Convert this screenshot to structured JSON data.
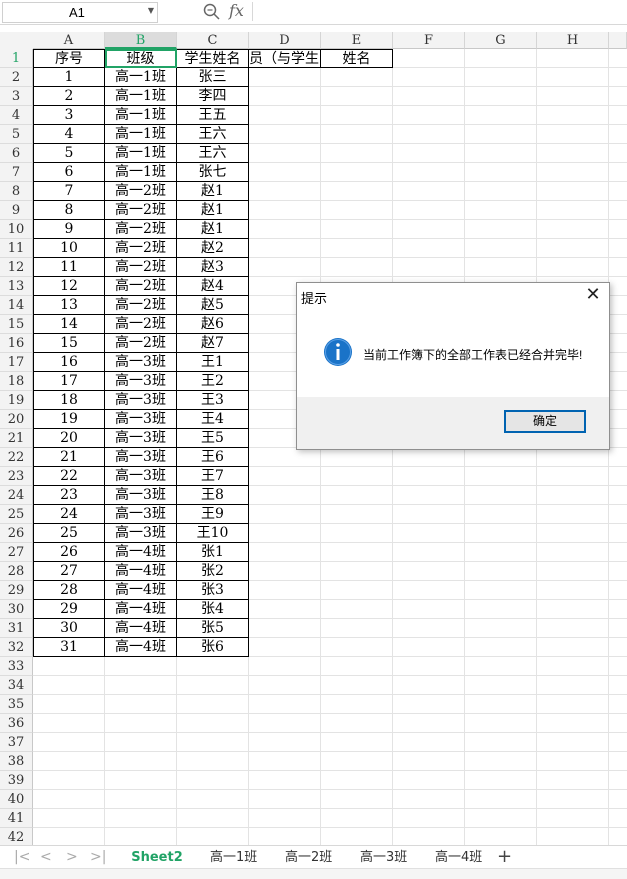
{
  "formula_bar": {
    "name_box": "A1",
    "fx": "fx"
  },
  "columns": [
    "A",
    "B",
    "C",
    "D",
    "E",
    "F",
    "G",
    "H"
  ],
  "selected_column": "B",
  "header_row": [
    "序号",
    "班级",
    "学生姓名",
    "员（与学生",
    "姓名"
  ],
  "rows": [
    [
      "1",
      "高一1班",
      "张三"
    ],
    [
      "2",
      "高一1班",
      "李四"
    ],
    [
      "3",
      "高一1班",
      "王五"
    ],
    [
      "4",
      "高一1班",
      "王六"
    ],
    [
      "5",
      "高一1班",
      "王六"
    ],
    [
      "6",
      "高一1班",
      "张七"
    ],
    [
      "7",
      "高一2班",
      "赵1"
    ],
    [
      "8",
      "高一2班",
      "赵1"
    ],
    [
      "9",
      "高一2班",
      "赵1"
    ],
    [
      "10",
      "高一2班",
      "赵2"
    ],
    [
      "11",
      "高一2班",
      "赵3"
    ],
    [
      "12",
      "高一2班",
      "赵4"
    ],
    [
      "13",
      "高一2班",
      "赵5"
    ],
    [
      "14",
      "高一2班",
      "赵6"
    ],
    [
      "15",
      "高一2班",
      "赵7"
    ],
    [
      "16",
      "高一3班",
      "王1"
    ],
    [
      "17",
      "高一3班",
      "王2"
    ],
    [
      "18",
      "高一3班",
      "王3"
    ],
    [
      "19",
      "高一3班",
      "王4"
    ],
    [
      "20",
      "高一3班",
      "王5"
    ],
    [
      "21",
      "高一3班",
      "王6"
    ],
    [
      "22",
      "高一3班",
      "王7"
    ],
    [
      "23",
      "高一3班",
      "王8"
    ],
    [
      "24",
      "高一3班",
      "王9"
    ],
    [
      "25",
      "高一3班",
      "王10"
    ],
    [
      "26",
      "高一4班",
      "张1"
    ],
    [
      "27",
      "高一4班",
      "张2"
    ],
    [
      "28",
      "高一4班",
      "张3"
    ],
    [
      "29",
      "高一4班",
      "张4"
    ],
    [
      "30",
      "高一4班",
      "张5"
    ],
    [
      "31",
      "高一4班",
      "张6"
    ]
  ],
  "row_numbers": [
    "1",
    "2",
    "3",
    "4",
    "5",
    "6",
    "7",
    "8",
    "9",
    "10",
    "11",
    "12",
    "13",
    "14",
    "15",
    "16",
    "17",
    "18",
    "19",
    "20",
    "21",
    "22",
    "23",
    "24",
    "25",
    "26",
    "27",
    "28",
    "29",
    "30",
    "31",
    "32",
    "33",
    "34",
    "35",
    "36",
    "37",
    "38",
    "39",
    "40",
    "41",
    "42"
  ],
  "sheet_tabs": [
    "Sheet2",
    "高一1班",
    "高一2班",
    "高一3班",
    "高一4班"
  ],
  "active_tab": "Sheet2",
  "dialog": {
    "title": "提示",
    "message": "当前工作簿下的全部工作表已经合并完毕!",
    "ok_label": "确定",
    "icon": "info-icon"
  },
  "colors": {
    "accent": "#21a366",
    "info_blue": "#1a73c8",
    "button_border": "#0063b1"
  }
}
